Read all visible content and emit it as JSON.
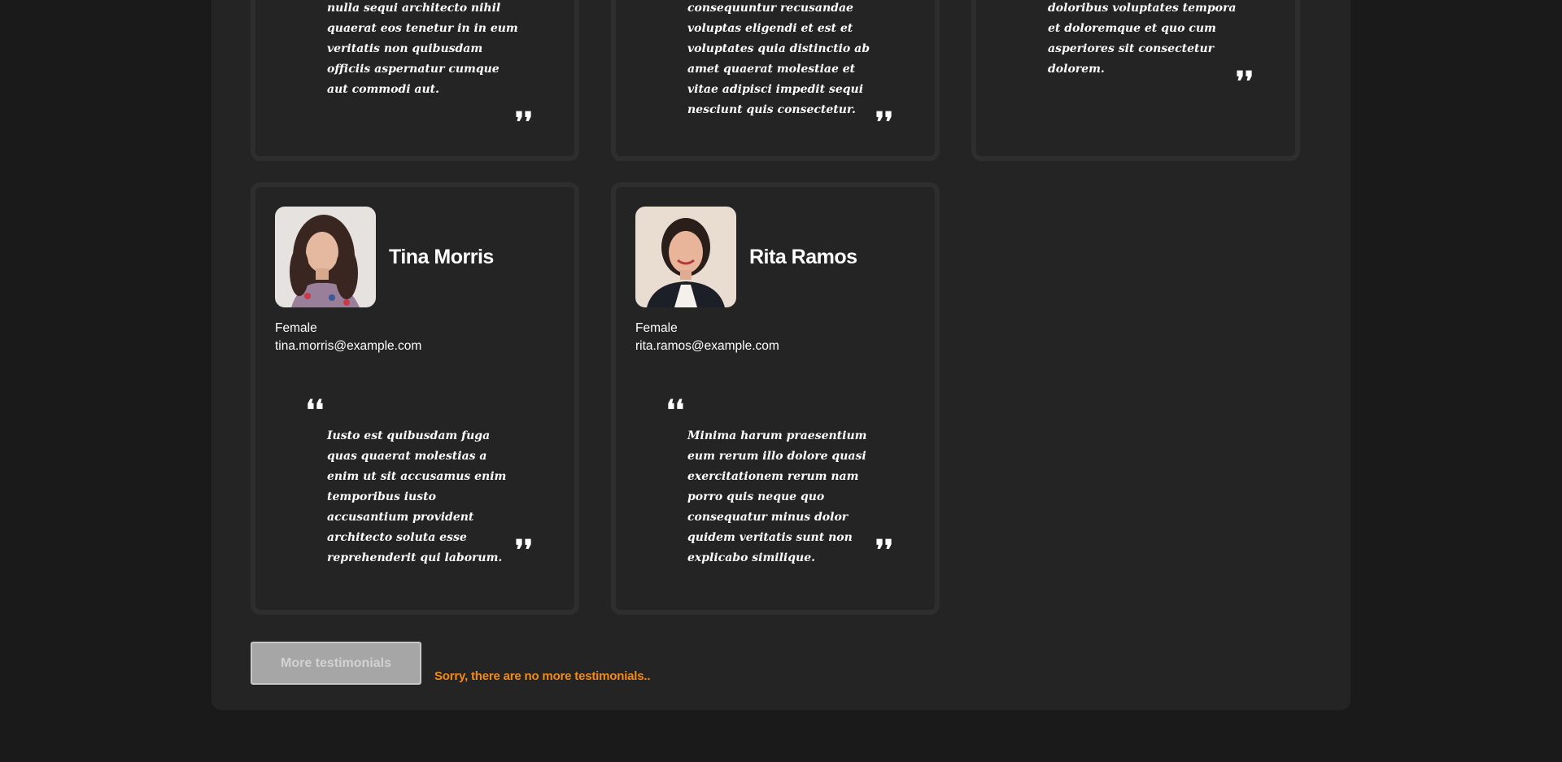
{
  "colors": {
    "page_background": "#1a1a1a",
    "panel_background": "#242424",
    "card_border": "#2e2e2e",
    "notice_text": "#f58a16",
    "button_background": "#a6a6a6"
  },
  "testimonials_partial": [
    {
      "text_lines": "nulla sequi architecto nihil quaerat eos tenetur in in eum veritatis non quibusdam officiis aspernatur cumque aut commodi aut."
    },
    {
      "text_lines": "consequuntur recusandae voluptas eligendi et est et voluptates quia distinctio ab amet quaerat molestiae et vitae adipisci impedit sequi nesciunt quis consectetur."
    },
    {
      "text_lines": "doloribus voluptates tempora et doloremque et quo cum asperiores sit consectetur dolorem."
    }
  ],
  "testimonials": [
    {
      "name": "Tina Morris",
      "gender": "Female",
      "email": "tina.morris@example.com",
      "quote": "Iusto est quibusdam fuga quas quaerat molestias a enim ut sit accusamus enim temporibus iusto accusantium provident architecto soluta esse reprehenderit qui laborum."
    },
    {
      "name": "Rita Ramos",
      "gender": "Female",
      "email": "rita.ramos@example.com",
      "quote": "Minima harum praesentium eum rerum illo dolore quasi exercitationem rerum nam porro quis neque quo consequatur minus dolor quidem veritatis sunt non explicabo similique."
    }
  ],
  "quote_marks": {
    "open": "❛❛",
    "close": "❜❜"
  },
  "actions": {
    "more_label": "More testimonials",
    "no_more_notice": "Sorry, there are no more testimonials.."
  }
}
